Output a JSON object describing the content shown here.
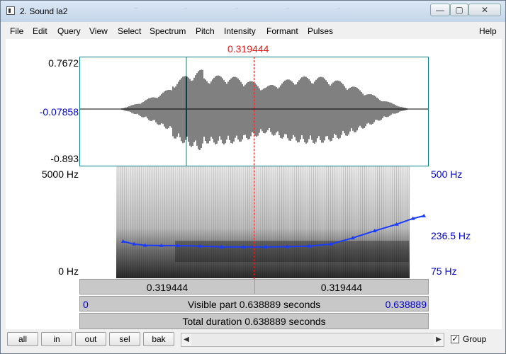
{
  "window": {
    "title": "2. Sound la2"
  },
  "ghost_tabs": [
    "...",
    "...",
    "...",
    "...",
    "..."
  ],
  "menu": [
    "File",
    "Edit",
    "Query",
    "View",
    "Select",
    "Spectrum",
    "Pitch",
    "Intensity",
    "Formant",
    "Pulses"
  ],
  "help": "Help",
  "cursor_time": "0.319444",
  "waveform": {
    "ymax": "0.7672",
    "ymid": "-0.07858",
    "ymin": "-0.893"
  },
  "spectrogram": {
    "ymax": "5000 Hz",
    "ymin": "0 Hz"
  },
  "pitch_axis": {
    "top": "500 Hz",
    "mid": "236.5 Hz",
    "bottom": "75 Hz"
  },
  "bars": {
    "left_time": "0.319444",
    "right_time": "0.319444",
    "visible_start": "0",
    "visible_text": "Visible part 0.638889 seconds",
    "visible_end": "0.638889",
    "total_text": "Total duration 0.638889 seconds"
  },
  "buttons": {
    "all": "all",
    "in": "in",
    "out": "out",
    "sel": "sel",
    "bak": "bak"
  },
  "group": {
    "label": "Group",
    "checked": true
  },
  "chart_data": {
    "type": "line",
    "title": "",
    "xlabel": "",
    "ylabel": "",
    "ylim": [
      75,
      500
    ],
    "x": [
      0.08,
      0.1,
      0.12,
      0.15,
      0.18,
      0.22,
      0.26,
      0.3,
      0.34,
      0.38,
      0.42,
      0.46,
      0.5,
      0.54,
      0.58,
      0.61,
      0.63
    ],
    "series": [
      {
        "values": [
          215,
          205,
          200,
          199,
          199,
          197,
          194,
          194,
          194,
          195,
          197,
          205,
          228,
          255,
          280,
          302,
          312
        ]
      }
    ],
    "colors": {
      "pitch": "#1a3cff",
      "cursor": "#e02020"
    }
  }
}
